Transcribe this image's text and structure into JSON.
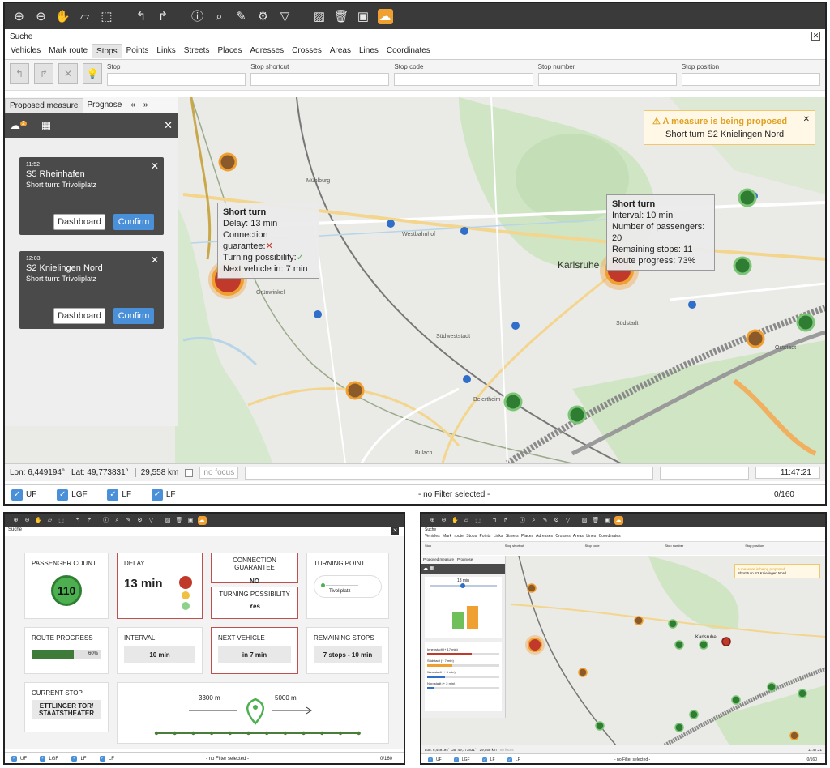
{
  "toolbar": {
    "icons": [
      "zoom-in-icon",
      "zoom-out-icon",
      "hand-icon",
      "ruler-icon",
      "select-icon",
      "undo-icon",
      "redo-icon",
      "info-icon",
      "search-icon",
      "pen-icon",
      "gear-icon",
      "filter-icon",
      "map-icon",
      "trash-icon",
      "bus-icon",
      "brain-icon"
    ]
  },
  "search": {
    "title": "Suche"
  },
  "tabs": [
    "Vehicles",
    "Mark route",
    "Stops",
    "Points",
    "Links",
    "Streets",
    "Places",
    "Adresses",
    "Crosses",
    "Areas",
    "Lines",
    "Coordinates"
  ],
  "fields": [
    "Stop",
    "Stop shortcut",
    "Stop code",
    "Stop number",
    "Stop position"
  ],
  "panel": {
    "tab1": "Proposed measure",
    "tab2": "Prognose",
    "badge": "2"
  },
  "cards": [
    {
      "time": "11:52",
      "title": "S5 Rheinhafen",
      "sub": "Short turn: Trivoliplatz",
      "dash": "Dashboard",
      "confirm": "Confirm"
    },
    {
      "time": "12:03",
      "title": "S2 Knielingen Nord",
      "sub": "Short turn: Trivoliplatz",
      "dash": "Dashboard",
      "confirm": "Confirm"
    }
  ],
  "popup1": {
    "title": "Short turn",
    "l1": "Delay: 13 min",
    "l2": "Connection guarantee:",
    "l3": "Turning possibility:",
    "l4": "Next vehicle in: 7 min"
  },
  "popup2": {
    "title": "Short turn",
    "l1": "Interval: 10 min",
    "l2": "Number of passengers: 20",
    "l3": "Remaining stops: 11",
    "l4": "Route progress: 73%"
  },
  "warning": {
    "title": "A measure is being proposed",
    "text": "Short turn S2 Knielingen Nord"
  },
  "map": {
    "city": "Karlsruhe",
    "labels": [
      "Mühlburg",
      "Westbahnhof",
      "Südweststadt",
      "Südstadt",
      "Beiertheim",
      "Grünwinkel",
      "Oststadt",
      "Bulach"
    ]
  },
  "status": {
    "lon": "Lon: 6,449194°",
    "lat": "Lat: 49,773831°",
    "dist": "29,558 km",
    "focus": "no focus",
    "time": "11:47:21"
  },
  "filters": {
    "items": [
      "UF",
      "LGF",
      "LF",
      "LF"
    ],
    "center": "- no Filter selected -",
    "count": "0/160"
  },
  "dashboard": {
    "passenger_label": "PASSENGER COUNT",
    "passenger_value": "110",
    "delay_label": "DELAY",
    "delay_value": "13 min",
    "conn_label": "CONNECTION GUARANTEE",
    "conn_value": "NO",
    "turnp_label": "TURNING POINT",
    "turnp_value": "Tivoliplatz",
    "turnposs_label": "TURNING POSSIBILITY",
    "turnposs_value": "Yes",
    "progress_label": "ROUTE PROGRESS",
    "progress_value": "60%",
    "progress_fraction": 0.6,
    "interval_label": "INTERVAL",
    "interval_value": "10 min",
    "next_label": "NEXT VEHICLE",
    "next_value": "in 7 min",
    "remaining_label": "REMAINING STOPS",
    "remaining_value": "7 stops - 10 min",
    "current_label": "CURRENT STOP",
    "current_value1": "ETTLINGER TOR/",
    "current_value2": "STAATSTHEATER",
    "dist_left": "3300 m",
    "dist_right": "5000 m"
  },
  "mini": {
    "title": "Suche",
    "tabs": "Vehicles  Mark route  Stops  Points  Links  Streets  Places  Adresses  Crosses  Areas  Lines  Coordinates",
    "value": "13 min",
    "sliders": [
      "Innenstadt (+ 17 min)",
      "Südstadt (+ 7 min)",
      "Weststadt (+ 5 min)",
      "Nordstadt (+ 2 min)"
    ],
    "status": "Lon: 6,449194°  Lat: 49,773831°",
    "dist": "29,558 km",
    "focus": "no focus",
    "time": "11:47:21",
    "city": "Karlsruhe",
    "warn_title": "A measure is being proposed",
    "warn_text": "Short turn S2 Knielingen Nord",
    "fields": [
      "Stop",
      "Stop shortcut",
      "Stop code",
      "Stop number",
      "Stop position"
    ],
    "tab1": "Proposed measure",
    "tab2": "Prognose"
  },
  "colors": {
    "accent": "#4a90d9",
    "orange": "#f0a030",
    "green": "#4caf50",
    "red": "#c0392b",
    "dark": "#3a3a3a"
  }
}
